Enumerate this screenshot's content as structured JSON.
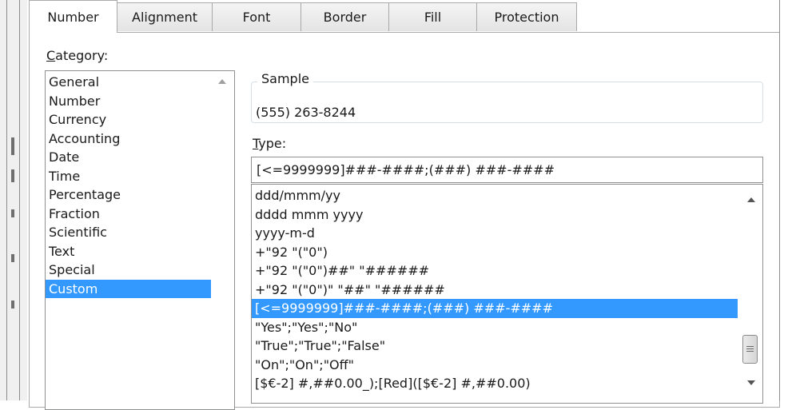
{
  "tabs": [
    {
      "label": "Number"
    },
    {
      "label": "Alignment"
    },
    {
      "label": "Font"
    },
    {
      "label": "Border"
    },
    {
      "label": "Fill"
    },
    {
      "label": "Protection"
    }
  ],
  "category": {
    "label_mnemonic": "C",
    "label_rest": "ategory:",
    "items": [
      "General",
      "Number",
      "Currency",
      "Accounting",
      "Date",
      "Time",
      "Percentage",
      "Fraction",
      "Scientific",
      "Text",
      "Special",
      "Custom"
    ],
    "selected": "Custom"
  },
  "sample": {
    "legend": "Sample",
    "value": "(555) 263-8244"
  },
  "type": {
    "label_mnemonic": "T",
    "label_rest": "ype:",
    "value": "[<=9999999]###-####;(###) ###-####"
  },
  "format_list": {
    "items": [
      "ddd/mmm/yy",
      "dddd mmm yyyy",
      "yyyy-m-d",
      "+\"92 \"(\"0\")",
      "+\"92 \"(\"0\")##\" \"######",
      "+\"92 \"(\"0\")\" \"##\" \"######",
      "[<=9999999]###-####;(###) ###-####",
      "\"Yes\";\"Yes\";\"No\"",
      "\"True\";\"True\";\"False\"",
      "\"On\";\"On\";\"Off\"",
      "[$€-2] #,##0.00_);[Red]([$€-2] #,##0.00)"
    ],
    "selected": "[<=9999999]###-####;(###) ###-####"
  },
  "colors": {
    "selection": "#3399ff",
    "border": "#a9a9a9"
  }
}
